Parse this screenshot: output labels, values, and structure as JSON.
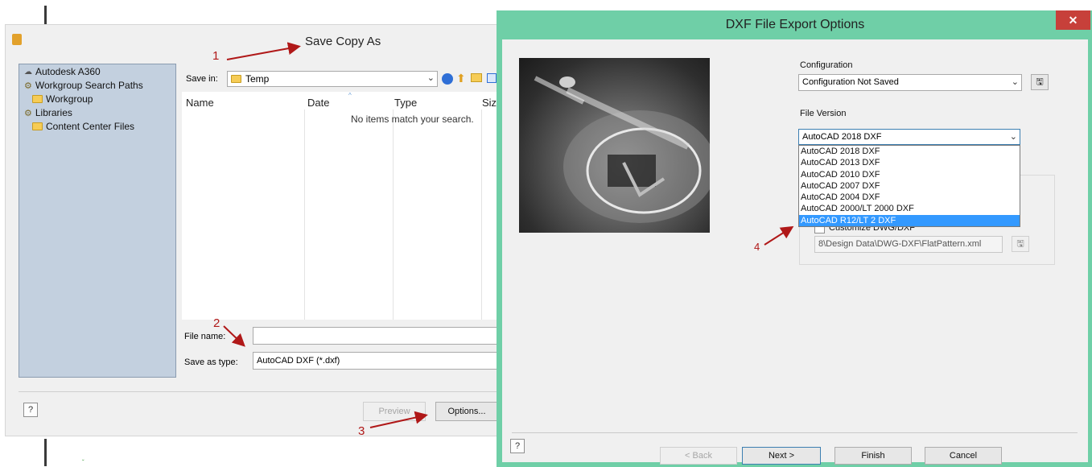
{
  "save_copy_as": {
    "title": "Save Copy As",
    "places": {
      "a360": "Autodesk A360",
      "search_paths": "Workgroup Search Paths",
      "workgroup": "Workgroup",
      "libraries": "Libraries",
      "content_center": "Content Center Files"
    },
    "save_in_label": "Save in:",
    "save_in_value": "Temp",
    "columns": [
      "Name",
      "Date",
      "Type",
      "Siz"
    ],
    "empty_message": "No items match your search.",
    "file_name_label": "File name:",
    "file_name_value": "",
    "save_as_type_label": "Save as type:",
    "save_as_type_value": "AutoCAD DXF (*.dxf)",
    "preview_button": "Preview",
    "options_button": "Options...",
    "help_glyph": "?"
  },
  "dxf_export": {
    "title": "DXF File Export Options",
    "close_glyph": "✕",
    "configuration_label": "Configuration",
    "configuration_value": "Configuration Not Saved",
    "file_version_label": "File Version",
    "file_version_value": "AutoCAD 2018 DXF",
    "version_options": [
      "AutoCAD 2018 DXF",
      "AutoCAD 2013 DXF",
      "AutoCAD 2010 DXF",
      "AutoCAD 2007 DXF",
      "AutoCAD 2004 DXF",
      "AutoCAD 2000/LT 2000 DXF",
      "AutoCAD R12/LT 2 DXF"
    ],
    "selected_option_index": 6,
    "customize_label_partial": "Customize DWG/DXF",
    "mapping_file_path": "8\\Design Data\\DWG-DXF\\FlatPattern.xml",
    "buttons": {
      "back": "< Back",
      "next": "Next >",
      "finish": "Finish",
      "cancel": "Cancel"
    },
    "help_glyph": "?"
  },
  "annotations": [
    "1",
    "2",
    "3",
    "4"
  ],
  "colors": {
    "dxf_title_bar": "#6fcfa7",
    "close_button": "#c7403a",
    "selected_item": "#3399ff",
    "annotation_arrow": "#b01818",
    "places_panel": "#c3d0df"
  }
}
